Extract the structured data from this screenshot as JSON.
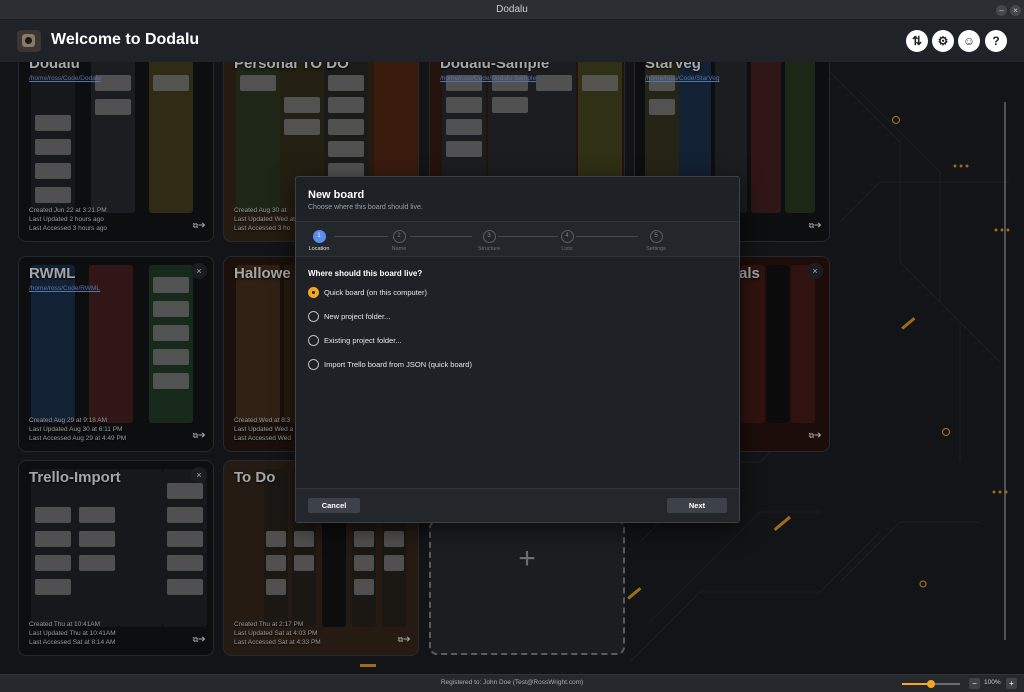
{
  "window": {
    "title": "Dodalu"
  },
  "header": {
    "title": "Welcome to Dodalu",
    "icons": [
      "sort-icon",
      "gear-icon",
      "robot-icon",
      "help-icon"
    ]
  },
  "boards": [
    {
      "name": "Dodalu",
      "path": "/home/ross/Code/Dodalu",
      "meta": [
        "Created Jun 22 at 3:21 PM",
        "Last Updated 2 hours ago",
        "Last Accessed 3 hours ago"
      ]
    },
    {
      "name": "Personal TO DO",
      "path": "",
      "meta": [
        "Created Aug 30 at",
        "Last Updated Wed at",
        "Last Accessed 3 ho"
      ]
    },
    {
      "name": "Dodalu-Sample",
      "path": "/home/ross/Code/Dodalu-Sample",
      "meta": []
    },
    {
      "name": "StarVeg",
      "path": "/home/ross/Code/StarVeg",
      "meta": []
    },
    {
      "name": "RWML",
      "path": "/home/ross/Code/RWML",
      "meta": [
        "Created Aug 29 at 9:18 AM",
        "Last Updated Aug 30 at 6:11 PM",
        "Last Accessed Aug 29 at 4:49 PM"
      ]
    },
    {
      "name": "Hallowe",
      "path": "",
      "meta": [
        "Created Wed at 8:3",
        "Last Updated Wed a",
        "Last Accessed Wed"
      ]
    },
    {
      "name": "als",
      "path": "",
      "meta": []
    },
    {
      "name": "Trello-Import",
      "path": "",
      "meta": [
        "Created Thu at 10:41AM",
        "Last Updated Thu at 10:41AM",
        "Last Accessed Sat at 8:14 AM"
      ]
    },
    {
      "name": "To Do",
      "path": "",
      "meta": [
        "Created Thu at 2:17 PM",
        "Last Updated Sat at 4:03 PM",
        "Last Accessed Sat at 4:33 PM"
      ]
    }
  ],
  "modal": {
    "title": "New board",
    "subtitle": "Choose where this board should live.",
    "steps": [
      {
        "num": "1",
        "label": "Location"
      },
      {
        "num": "2",
        "label": "Name"
      },
      {
        "num": "3",
        "label": "Structure"
      },
      {
        "num": "4",
        "label": "Lists"
      },
      {
        "num": "5",
        "label": "Settings"
      }
    ],
    "active_step": 1,
    "question": "Where should this board live?",
    "options": [
      {
        "label": "Quick board (on this computer)",
        "selected": true
      },
      {
        "label": "New project folder...",
        "selected": false
      },
      {
        "label": "Existing project folder...",
        "selected": false
      },
      {
        "label": "Import Trello board from JSON (quick board)",
        "selected": false
      }
    ],
    "cancel_label": "Cancel",
    "next_label": "Next"
  },
  "statusbar": {
    "registered": "Registered to: John Doe (Test@RossWright.com)",
    "zoom": "100%",
    "zoom_level": 0.5
  },
  "colors": {
    "accent": "#f5a623",
    "step_active": "#5b8def",
    "link": "#7fb2ff"
  }
}
